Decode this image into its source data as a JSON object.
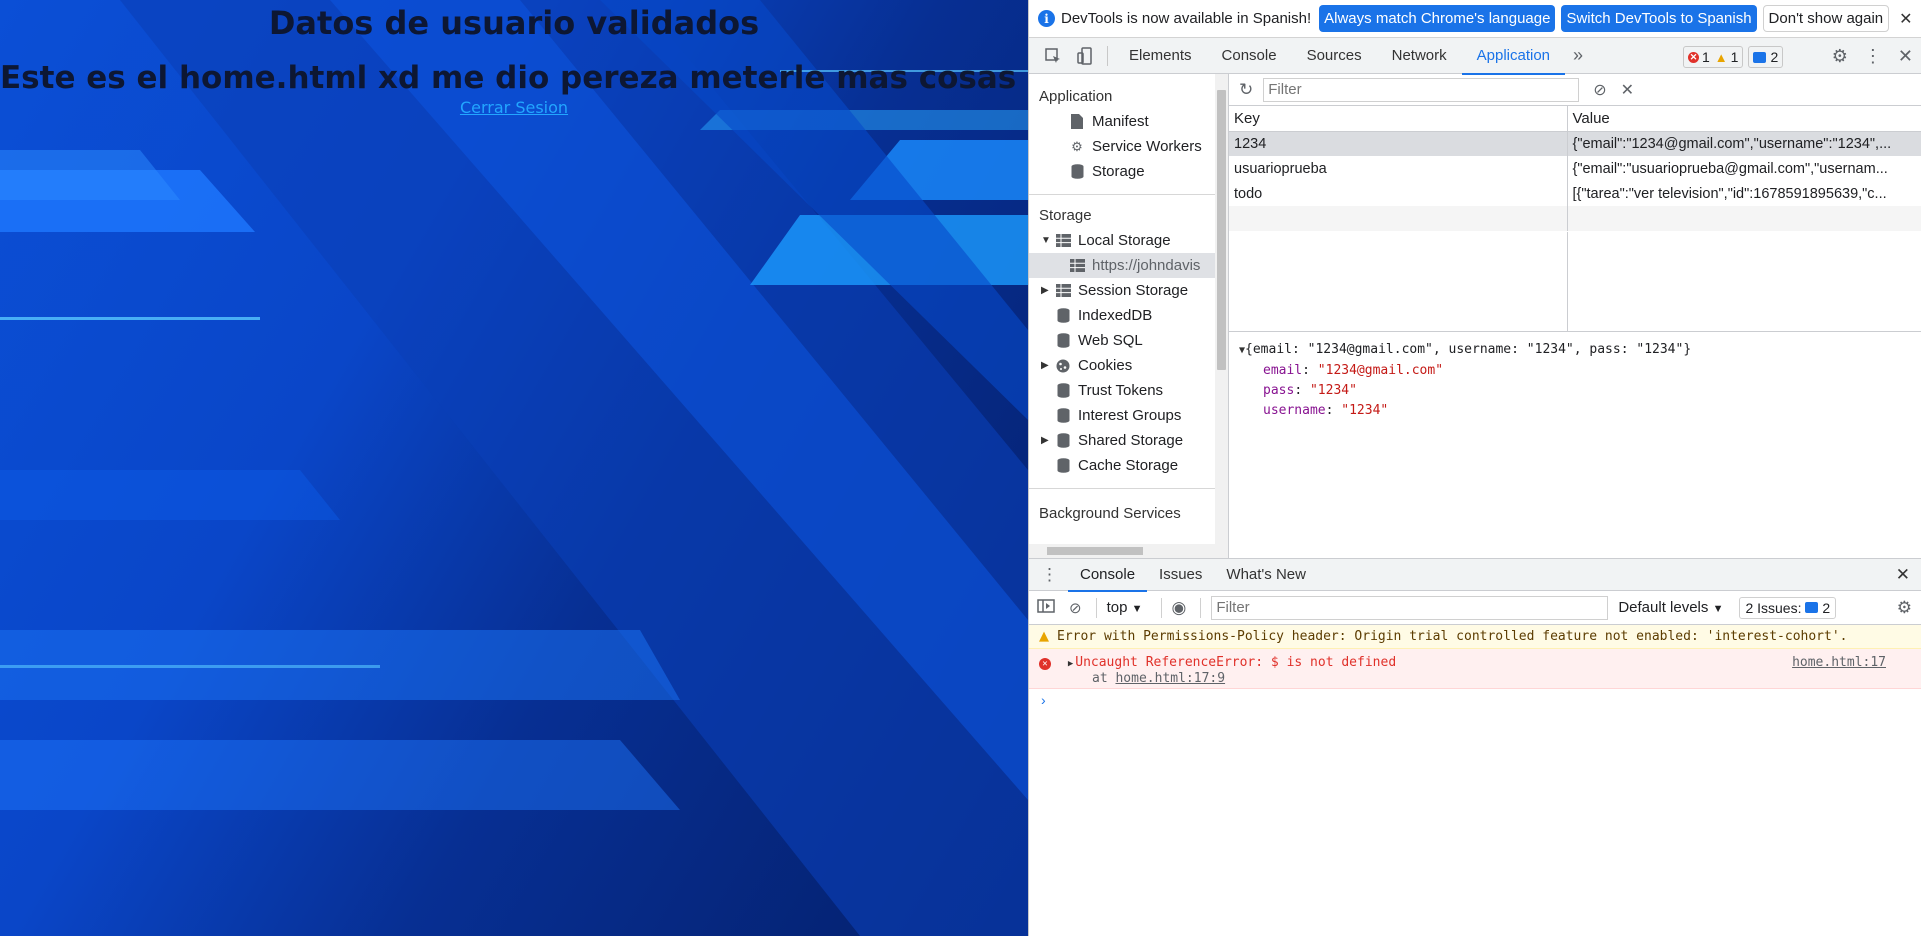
{
  "page": {
    "heading": "Datos de usuario validados",
    "subheading": "Este es el home.html xd me dio pereza meterle mas cosas aqui xd",
    "logout_link": "Cerrar Sesion"
  },
  "infobar": {
    "message": "DevTools is now available in Spanish!",
    "btn_match": "Always match Chrome's language",
    "btn_switch": "Switch DevTools to Spanish",
    "btn_dismiss": "Don't show again",
    "close": "✕"
  },
  "tabs": {
    "items": [
      "Elements",
      "Console",
      "Sources",
      "Network",
      "Application"
    ],
    "active": "Application",
    "more": "»",
    "errors": "1",
    "warnings": "1",
    "issues": "2"
  },
  "sidebar": {
    "app_header": "Application",
    "app_items": [
      "Manifest",
      "Service Workers",
      "Storage"
    ],
    "storage_header": "Storage",
    "local_storage": "Local Storage",
    "local_origin": "https://johndavis",
    "session_storage": "Session Storage",
    "indexeddb": "IndexedDB",
    "websql": "Web SQL",
    "cookies": "Cookies",
    "trust_tokens": "Trust Tokens",
    "interest_groups": "Interest Groups",
    "shared_storage": "Shared Storage",
    "cache_storage": "Cache Storage",
    "bg_header": "Background Services"
  },
  "storage_table": {
    "filter_placeholder": "Filter",
    "col_key": "Key",
    "col_value": "Value",
    "rows": [
      {
        "key": "1234",
        "value": "{\"email\":\"1234@gmail.com\",\"username\":\"1234\",..."
      },
      {
        "key": "usuarioprueba",
        "value": "{\"email\":\"usuarioprueba@gmail.com\",\"usernam..."
      },
      {
        "key": "todo",
        "value": "[{\"tarea\":\"ver television\",\"id\":1678591895639,\"c..."
      }
    ]
  },
  "preview": {
    "summary": "{email: \"1234@gmail.com\", username: \"1234\", pass: \"1234\"}",
    "fields": [
      {
        "k": "email",
        "v": "\"1234@gmail.com\""
      },
      {
        "k": "pass",
        "v": "\"1234\""
      },
      {
        "k": "username",
        "v": "\"1234\""
      }
    ]
  },
  "drawer": {
    "tabs": [
      "Console",
      "Issues",
      "What's New"
    ],
    "context": "top",
    "filter_placeholder": "Filter",
    "levels": "Default levels",
    "issues_label": "2 Issues:",
    "issues_count": "2"
  },
  "console": {
    "warning": "Error with Permissions-Policy header: Origin trial controlled feature not enabled: 'interest-cohort'.",
    "error_main": "Uncaught ReferenceError: $ is not defined",
    "error_at": "at",
    "error_loc": "home.html:17:9",
    "error_src": "home.html:17",
    "prompt": "›"
  },
  "colors": {
    "accent": "#1a73e8",
    "error": "#e0312a",
    "warning": "#e8a400",
    "link": "#22a6ff"
  }
}
